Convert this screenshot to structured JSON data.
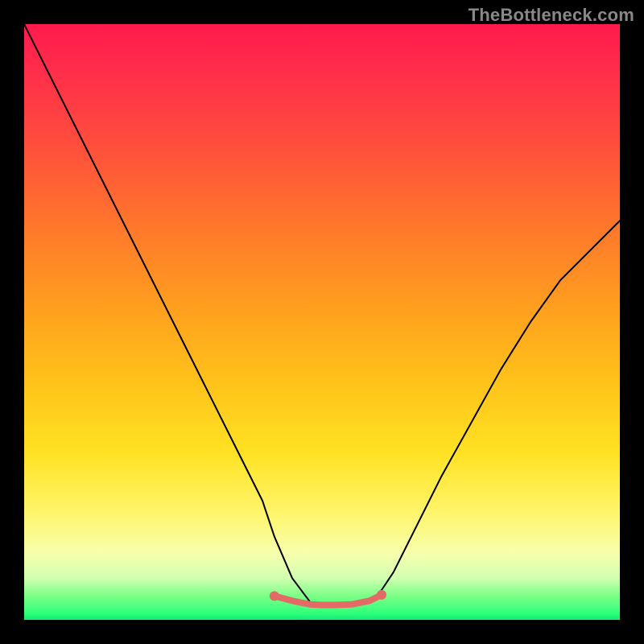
{
  "watermark": "TheBottleneck.com",
  "colors": {
    "curve_stroke": "#000000",
    "red_segment_stroke": "#e46a66",
    "red_segment_dots": "#e46a66",
    "gradient_top": "#ff1a4d",
    "gradient_bottom": "#12e873",
    "frame_bg": "#000000"
  },
  "chart_data": {
    "type": "line",
    "title": "",
    "xlabel": "",
    "ylabel": "",
    "xlim": [
      0,
      100
    ],
    "ylim": [
      0,
      100
    ],
    "grid": false,
    "legend": false,
    "series": [
      {
        "name": "bottleneck-curve",
        "x": [
          0,
          5,
          10,
          15,
          20,
          25,
          30,
          35,
          40,
          42,
          45,
          48,
          50,
          52,
          55,
          58,
          60,
          62,
          65,
          70,
          75,
          80,
          85,
          90,
          95,
          100
        ],
        "values": [
          100,
          90,
          80,
          70,
          60,
          50,
          40,
          30,
          20,
          14,
          7,
          3,
          2.5,
          2.5,
          2.5,
          3,
          5,
          8,
          14,
          24,
          33,
          42,
          50,
          57,
          62,
          67
        ]
      }
    ],
    "highlight_segment": {
      "name": "optimal-range",
      "x": [
        42,
        45,
        48,
        50,
        52,
        55,
        58,
        60
      ],
      "values": [
        4,
        3.2,
        2.6,
        2.5,
        2.5,
        2.6,
        3.2,
        4.2
      ],
      "dot_indices": [
        0,
        7
      ]
    }
  }
}
